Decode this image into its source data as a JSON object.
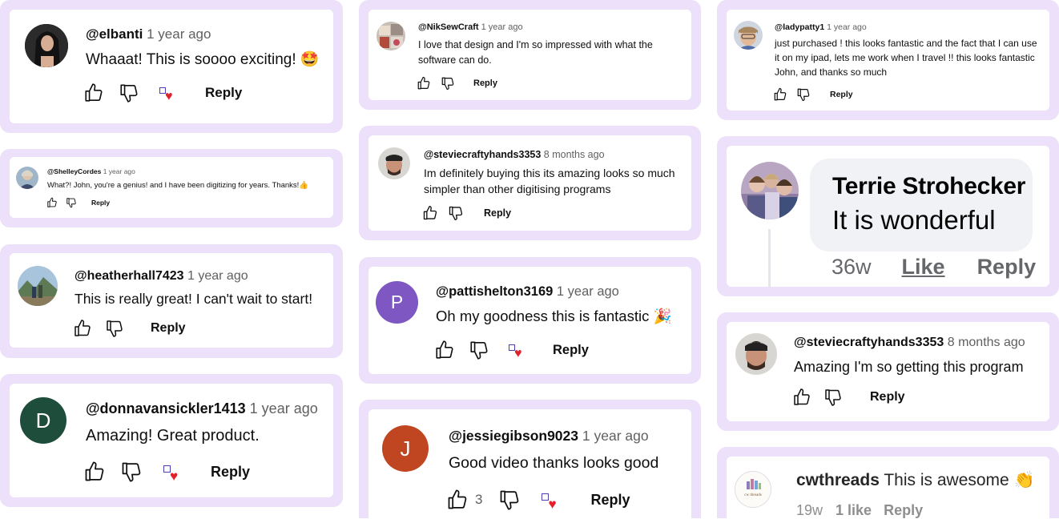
{
  "comments": [
    {
      "handle": "@elbanti",
      "ago": "1 year ago",
      "text": "Whaaat! This is soooo exciting! 🤩",
      "reply": "Reply"
    },
    {
      "handle": "@ShelleyCordes",
      "ago": "1 year ago",
      "text": "What?! John, you're a genius! and I have been digitizing for years. Thanks!👍",
      "reply": "Reply"
    },
    {
      "handle": "@heatherhall7423",
      "ago": "1 year ago",
      "text": "This is really great! I can't wait to start!",
      "reply": "Reply"
    },
    {
      "handle": "@donnavansickler1413",
      "ago": "1 year ago",
      "text": "Amazing! Great product.",
      "reply": "Reply",
      "avatar_letter": "D",
      "avatar_color": "#1e4d3b"
    },
    {
      "handle": "@NikSewCraft",
      "ago": "1 year ago",
      "text": "I love that design and I'm so impressed with what the software can do.",
      "reply": "Reply"
    },
    {
      "handle": "@steviecraftyhands3353",
      "ago": "8 months ago",
      "text": "Im definitely buying this its amazing looks so much simpler than other digitising programs",
      "reply": "Reply"
    },
    {
      "handle": "@pattishelton3169",
      "ago": "1 year ago",
      "text": "Oh my goodness this is fantastic 🎉",
      "reply": "Reply",
      "avatar_letter": "P",
      "avatar_color": "#7e57c2"
    },
    {
      "handle": "@jessiegibson9023",
      "ago": "1 year ago",
      "text": "Good video thanks looks good",
      "reply": "Reply",
      "likes": "3",
      "avatar_letter": "J",
      "avatar_color": "#bf4621"
    },
    {
      "handle": "@ladypatty1",
      "ago": "1 year ago",
      "text": "just purchased ! this looks fantastic and the fact that I can use it on my ipad, lets me work when I travel !! this looks fantastic John, and thanks so much",
      "reply": "Reply"
    },
    {
      "handle": "@steviecraftyhands3353",
      "ago": "8 months ago",
      "text": "Amazing I'm so getting this program",
      "reply": "Reply"
    }
  ],
  "fb_comment": {
    "name": "Terrie Strohecker",
    "text": "It is wonderful",
    "time": "36w",
    "like": "Like",
    "reply": "Reply"
  },
  "ig_comment": {
    "handle": "cwthreads",
    "text": "This is awesome 👏",
    "time": "19w",
    "likes": "1 like",
    "reply": "Reply",
    "avatar_text": "cw threads"
  },
  "colors": {
    "frame": "#ece0fa",
    "heart": "#e3212a",
    "text": "#0f0f0f",
    "muted": "#606060"
  },
  "icons": [
    "thumbs-up-icon",
    "thumbs-down-icon",
    "creator-heart-icon"
  ]
}
